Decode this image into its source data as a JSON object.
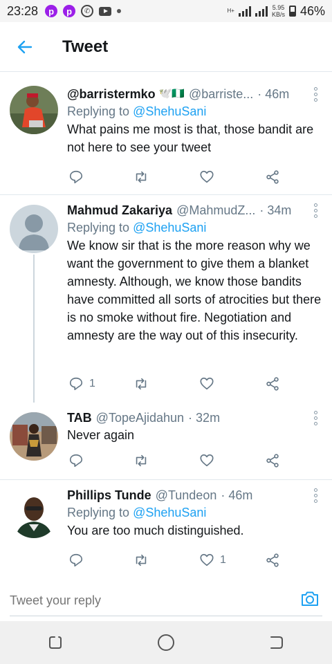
{
  "status_bar": {
    "time": "23:28",
    "network_label": "H+",
    "speed_value": "5.95",
    "speed_unit": "KB/s",
    "battery": "46%"
  },
  "header": {
    "title": "Tweet",
    "back_icon": "arrow-left-icon"
  },
  "tweets": [
    {
      "name": "@barristermko",
      "name_suffix": "🕊️🇳🇬",
      "handle": "@barriste...",
      "time": "· 46m",
      "replying_prefix": "Replying to ",
      "replying_to": "@ShehuSani",
      "text": "What pains me most is that, those bandit are not here to see your tweet",
      "reply_count": "",
      "retweet_count": "",
      "like_count": ""
    },
    {
      "name": "Mahmud Zakariya",
      "handle": "@MahmudZ...",
      "time": "· 34m",
      "replying_prefix": "Replying to ",
      "replying_to": "@ShehuSani",
      "text": "We know sir that is the more reason why we want the government to give them a blanket amnesty. Although, we know those bandits have committed all sorts of atrocities but there is no smoke without fire. Negotiation and amnesty are the way out of this insecurity.",
      "reply_count": "1",
      "retweet_count": "",
      "like_count": ""
    },
    {
      "name": "TAB",
      "handle": "@TopeAjidahun",
      "time": "· 32m",
      "text": "Never again",
      "reply_count": "",
      "retweet_count": "",
      "like_count": ""
    },
    {
      "name": "Phillips Tunde",
      "handle": "@Tundeon",
      "time": "· 46m",
      "replying_prefix": "Replying to ",
      "replying_to": "@ShehuSani",
      "text": "You are too much distinguished.",
      "reply_count": "",
      "retweet_count": "",
      "like_count": "1"
    }
  ],
  "reply_bar": {
    "placeholder": "Tweet your reply"
  },
  "colors": {
    "accent": "#1da1f2",
    "secondary_text": "#657786",
    "divider": "#e1e8ed"
  }
}
